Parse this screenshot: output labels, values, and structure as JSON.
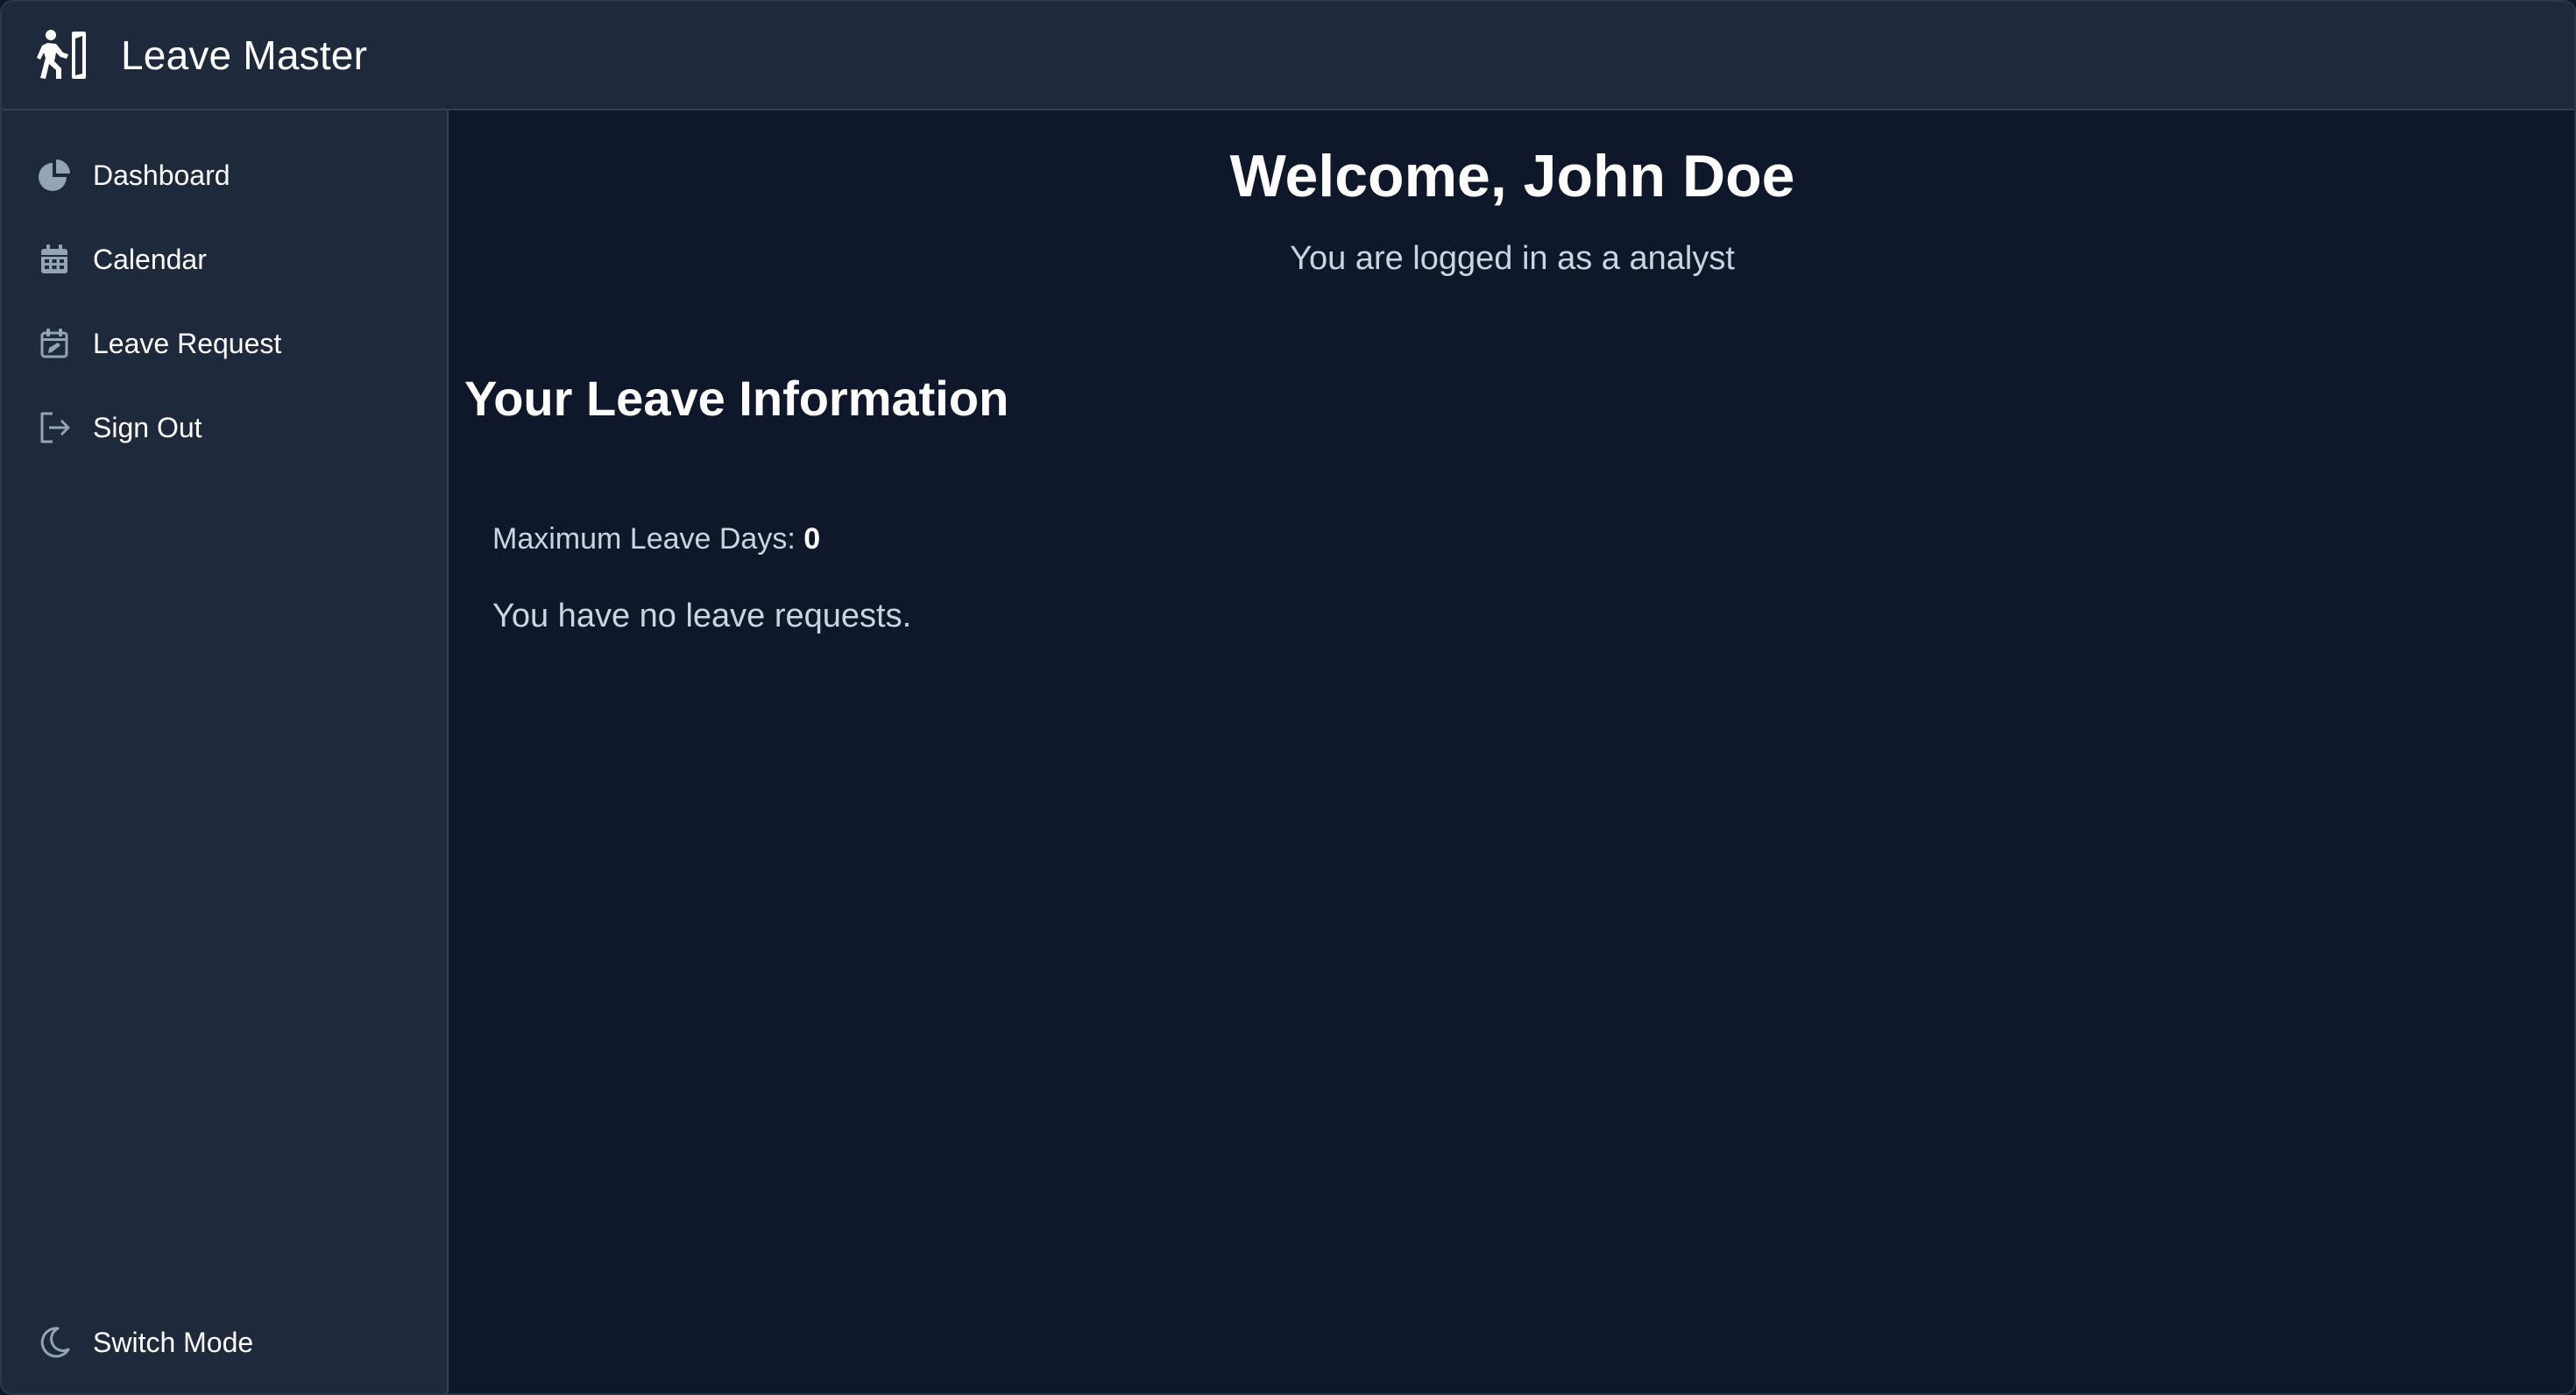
{
  "app": {
    "title": "Leave Master",
    "logo_icon": "walking-person-door-icon"
  },
  "sidebar": {
    "items": [
      {
        "label": "Dashboard",
        "icon": "pie-chart-icon"
      },
      {
        "label": "Calendar",
        "icon": "calendar-icon"
      },
      {
        "label": "Leave Request",
        "icon": "calendar-edit-icon"
      },
      {
        "label": "Sign Out",
        "icon": "sign-out-icon"
      }
    ],
    "footer": {
      "label": "Switch Mode",
      "icon": "moon-icon"
    }
  },
  "main": {
    "welcome": "Welcome, John Doe",
    "role_text": "You are logged in as a analyst",
    "section_title": "Your Leave Information",
    "max_leave_label": "Maximum Leave Days:",
    "max_leave_value": "0",
    "no_requests_text": "You have no leave requests."
  },
  "colors": {
    "background": "#0f172a",
    "panel": "#1e293b",
    "border": "#334155",
    "text": "#ffffff",
    "muted_text": "#cbd5e1",
    "icon": "#94a3b8"
  }
}
